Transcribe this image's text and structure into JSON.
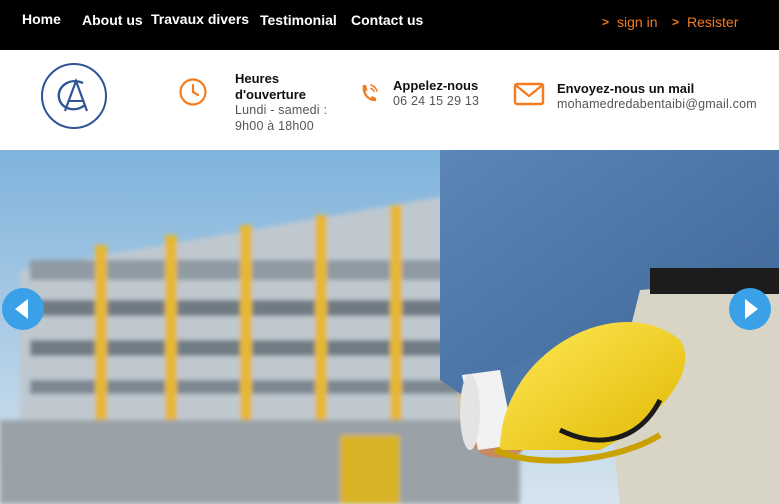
{
  "nav": {
    "links": [
      "Home",
      "About us",
      "Travaux divers",
      "Testimonial",
      "Contact us"
    ],
    "sign_in": "sign in",
    "register": "Resister",
    "chevron": ">"
  },
  "contact": {
    "hours_title_1": "Heures",
    "hours_title_2": "d'ouverture",
    "hours_line_1": "Lundi - samedi :",
    "hours_line_2": "9h00 à 18h00",
    "phone_title": "Appelez-nous",
    "phone_number": "06 24 15 29 13",
    "mail_title": "Envoyez-nous un mail",
    "mail_address": "mohamedredabentaibi@gmail.com"
  },
  "logo": {
    "letters": "CA"
  },
  "colors": {
    "accent": "#f47b20",
    "nav_bg": "#000000",
    "logo_blue": "#2f5597",
    "arrow_blue": "#3aa0e8"
  },
  "icons": [
    "clock-icon",
    "phone-icon",
    "envelope-icon",
    "arrow-left-icon",
    "arrow-right-icon"
  ]
}
